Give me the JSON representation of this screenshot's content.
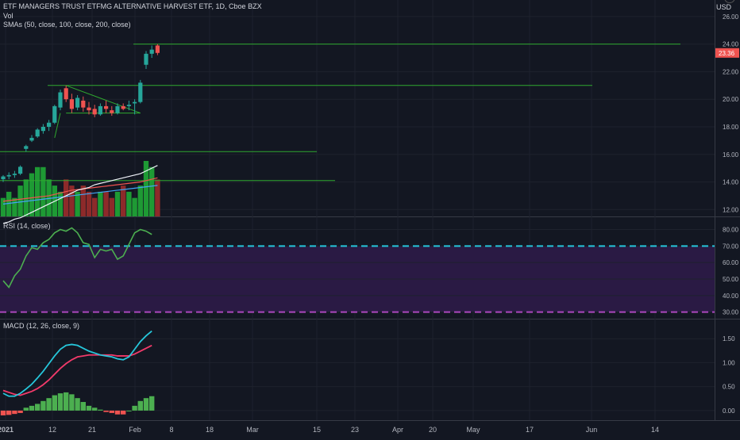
{
  "header": {
    "title": "ETF MANAGERS TRUST ETFMG ALTERNATIVE HARVEST ETF, 1D, Cboe BZX",
    "vol_label": "Vol",
    "sma_label": "SMAs (50, close, 100, close, 200, close)",
    "currency": "USD"
  },
  "rsi_panel": {
    "label": "RSI (14, close)"
  },
  "macd_panel": {
    "label": "MACD (12, 26, close, 9)"
  },
  "colors": {
    "background": "#131722",
    "grid": "#1e222d",
    "up": "#26a69a",
    "down": "#ef5350",
    "vol_up": "#1e9a34",
    "vol_down": "#8d2a2a",
    "sma50": "#f0f3fa",
    "sma100": "#42a5f5",
    "sma200": "#ef5350",
    "hline": "#2fa82f",
    "rsi_line": "#4caf50",
    "rsi_band": "#2a1a44",
    "rsi_upper": "#26c6da",
    "rsi_lower": "#ab47bc",
    "macd_line": "#26c6da",
    "signal_line": "#f23a6a",
    "hist_up": "#4caf50",
    "hist_down": "#ef5350"
  },
  "chart_data": [
    {
      "type": "candlestick",
      "title": "ETF MANAGERS TRUST ETFMG ALTERNATIVE HARVEST ETF, 1D, Cboe BZX",
      "ylabel": "USD",
      "y_ticks": [
        "26.00",
        "24.00",
        "22.00",
        "20.00",
        "18.00",
        "16.00",
        "14.00",
        "12.00"
      ],
      "ylim": [
        11.5,
        27.2
      ],
      "last_price_label": "23.36",
      "x_tick_labels": [
        "2021",
        "12",
        "21",
        "Feb",
        "8",
        "18",
        "Mar",
        "15",
        "23",
        "Apr",
        "20",
        "May",
        "17",
        "Jun",
        "14"
      ],
      "candles": [
        {
          "o": 14.2,
          "h": 14.5,
          "l": 14.0,
          "c": 14.4
        },
        {
          "o": 14.4,
          "h": 14.7,
          "l": 14.2,
          "c": 14.5
        },
        {
          "o": 14.5,
          "h": 14.8,
          "l": 14.3,
          "c": 14.6
        },
        {
          "o": 14.6,
          "h": 15.2,
          "l": 14.5,
          "c": 15.1
        },
        {
          "o": 16.4,
          "h": 16.7,
          "l": 16.2,
          "c": 16.6
        },
        {
          "o": 17.0,
          "h": 17.4,
          "l": 16.9,
          "c": 17.2
        },
        {
          "o": 17.3,
          "h": 17.9,
          "l": 17.2,
          "c": 17.8
        },
        {
          "o": 17.7,
          "h": 18.2,
          "l": 17.5,
          "c": 18.0
        },
        {
          "o": 18.0,
          "h": 18.5,
          "l": 17.7,
          "c": 18.3
        },
        {
          "o": 18.3,
          "h": 19.6,
          "l": 18.2,
          "c": 19.5
        },
        {
          "o": 19.4,
          "h": 20.7,
          "l": 19.2,
          "c": 20.5
        },
        {
          "o": 20.8,
          "h": 21.0,
          "l": 19.8,
          "c": 20.0
        },
        {
          "o": 20.0,
          "h": 20.4,
          "l": 19.0,
          "c": 19.3
        },
        {
          "o": 19.4,
          "h": 20.3,
          "l": 19.2,
          "c": 20.1
        },
        {
          "o": 19.9,
          "h": 20.2,
          "l": 19.1,
          "c": 19.4
        },
        {
          "o": 19.4,
          "h": 19.8,
          "l": 18.9,
          "c": 19.2
        },
        {
          "o": 19.3,
          "h": 19.6,
          "l": 18.7,
          "c": 18.9
        },
        {
          "o": 18.9,
          "h": 19.7,
          "l": 18.8,
          "c": 19.5
        },
        {
          "o": 19.5,
          "h": 19.9,
          "l": 19.0,
          "c": 19.3
        },
        {
          "o": 19.2,
          "h": 19.5,
          "l": 18.8,
          "c": 19.0
        },
        {
          "o": 19.0,
          "h": 19.7,
          "l": 18.9,
          "c": 19.5
        },
        {
          "o": 19.5,
          "h": 19.7,
          "l": 19.2,
          "c": 19.3
        },
        {
          "o": 19.5,
          "h": 19.9,
          "l": 19.2,
          "c": 19.6
        },
        {
          "o": 19.7,
          "h": 20.0,
          "l": 18.9,
          "c": 19.8
        },
        {
          "o": 19.8,
          "h": 21.4,
          "l": 19.7,
          "c": 21.2
        },
        {
          "o": 22.5,
          "h": 23.5,
          "l": 22.2,
          "c": 23.3
        },
        {
          "o": 23.3,
          "h": 23.9,
          "l": 23.0,
          "c": 23.6
        },
        {
          "o": 23.9,
          "h": 24.0,
          "l": 23.2,
          "c": 23.36
        }
      ],
      "volume": [
        3,
        4,
        3,
        5,
        6,
        7,
        8,
        8,
        6,
        5,
        4,
        6,
        5,
        4,
        5,
        4,
        3,
        4,
        4,
        3,
        4,
        5,
        4,
        3,
        5,
        9,
        8,
        6
      ],
      "sma50": [
        13.6,
        13.7,
        13.9,
        14.0,
        14.2,
        14.4,
        14.6,
        14.8,
        15.0,
        15.2,
        15.4,
        15.6,
        15.8,
        16.0,
        16.1,
        16.2,
        16.4,
        16.5,
        16.6,
        16.7,
        16.8,
        16.9,
        17.0,
        17.1,
        17.2,
        17.4,
        17.6,
        17.8
      ],
      "sma100": [
        12.4,
        12.45,
        12.5,
        12.55,
        12.6,
        12.65,
        12.7,
        12.75,
        12.8,
        12.85,
        12.9,
        12.95,
        13.0,
        13.05,
        13.1,
        13.15,
        13.2,
        13.25,
        13.3,
        13.35,
        13.4,
        13.45,
        13.5,
        13.55,
        13.6,
        13.65,
        13.7,
        13.75
      ],
      "sma200": [
        12.6,
        12.65,
        12.7,
        12.75,
        12.8,
        12.85,
        12.9,
        12.95,
        13.0,
        13.1,
        13.2,
        13.3,
        13.4,
        13.45,
        13.5,
        13.55,
        13.6,
        13.65,
        13.7,
        13.75,
        13.8,
        13.85,
        13.9,
        13.95,
        14.0,
        14.1,
        14.2,
        14.3
      ],
      "horizontal_lines": [
        24.0,
        21.0,
        16.2,
        14.1
      ]
    },
    {
      "type": "line",
      "title": "RSI (14, close)",
      "y_ticks": [
        "80.00",
        "70.00",
        "60.00",
        "50.00",
        "40.00",
        "30.00"
      ],
      "ylim": [
        26,
        86
      ],
      "levels": [
        70,
        30
      ],
      "values": [
        49,
        45,
        52,
        56,
        64,
        69,
        68,
        72,
        74,
        78,
        80,
        79,
        81,
        78,
        72,
        71,
        63,
        68,
        67,
        68,
        62,
        64,
        71,
        78,
        80,
        79,
        77
      ]
    },
    {
      "type": "line",
      "title": "MACD (12, 26, close, 9)",
      "y_ticks": [
        "1.50",
        "1.00",
        "0.50",
        "0.00"
      ],
      "ylim": [
        -0.2,
        1.9
      ],
      "macd": [
        0.36,
        0.3,
        0.3,
        0.36,
        0.45,
        0.55,
        0.68,
        0.82,
        0.98,
        1.14,
        1.28,
        1.36,
        1.38,
        1.36,
        1.3,
        1.24,
        1.2,
        1.16,
        1.14,
        1.12,
        1.08,
        1.06,
        1.12,
        1.28,
        1.44,
        1.56,
        1.66
      ],
      "signal": [
        0.42,
        0.38,
        0.34,
        0.32,
        0.36,
        0.4,
        0.46,
        0.54,
        0.64,
        0.76,
        0.88,
        0.98,
        1.06,
        1.12,
        1.14,
        1.16,
        1.16,
        1.16,
        1.16,
        1.16,
        1.14,
        1.14,
        1.14,
        1.18,
        1.24,
        1.3,
        1.36
      ],
      "histogram": [
        -0.1,
        -0.09,
        -0.07,
        -0.05,
        0.06,
        0.1,
        0.14,
        0.2,
        0.26,
        0.32,
        0.36,
        0.38,
        0.34,
        0.26,
        0.18,
        0.1,
        0.06,
        0.02,
        -0.03,
        -0.05,
        -0.08,
        -0.08,
        0.0,
        0.1,
        0.2,
        0.26,
        0.3
      ]
    }
  ]
}
